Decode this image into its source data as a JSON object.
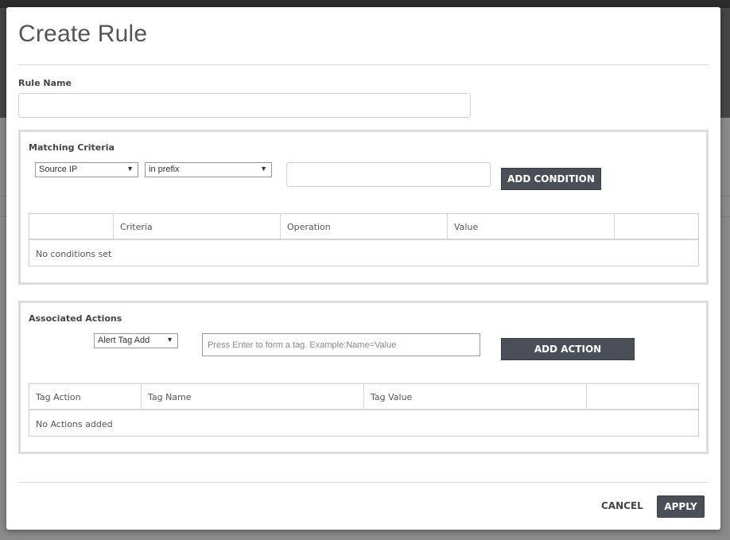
{
  "dialog": {
    "title": "Create Rule"
  },
  "rule_name": {
    "label": "Rule Name",
    "value": "",
    "placeholder": ""
  },
  "matching_criteria": {
    "heading": "Matching Criteria",
    "criteria_select": "Source IP",
    "operation_select": "in prefix",
    "value_input": "",
    "add_button": "ADD CONDITION",
    "table": {
      "columns": [
        "",
        "Criteria",
        "Operation",
        "Value",
        ""
      ],
      "empty_message": "No conditions set"
    }
  },
  "associated_actions": {
    "heading": "Associated Actions",
    "action_select": "Alert Tag Add",
    "tag_input_placeholder": "Press Enter to form a tag. Example:Name=Value",
    "add_button": "ADD ACTION",
    "table": {
      "columns": [
        "Tag Action",
        "Tag Name",
        "Tag Value",
        ""
      ],
      "empty_message": "No Actions added"
    }
  },
  "footer": {
    "cancel": "CANCEL",
    "apply": "APPLY"
  },
  "icons": {
    "dropdown": "▼"
  }
}
